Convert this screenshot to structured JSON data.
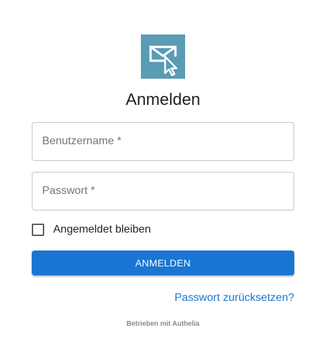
{
  "brand": {
    "logo_icon": "mail-cursor-icon",
    "logo_color": "#5a9bb5"
  },
  "title": "Anmelden",
  "form": {
    "username_placeholder": "Benutzername *",
    "username_value": "",
    "password_placeholder": "Passwort *",
    "password_value": "",
    "remember_label": "Angemeldet bleiben",
    "remember_checked": false,
    "submit_label": "ANMELDEN",
    "reset_link": "Passwort zurücksetzen?"
  },
  "footer": "Betrieben mit Authelia",
  "colors": {
    "primary": "#1976d2",
    "border": "#c4c4c4",
    "text": "#222222"
  }
}
